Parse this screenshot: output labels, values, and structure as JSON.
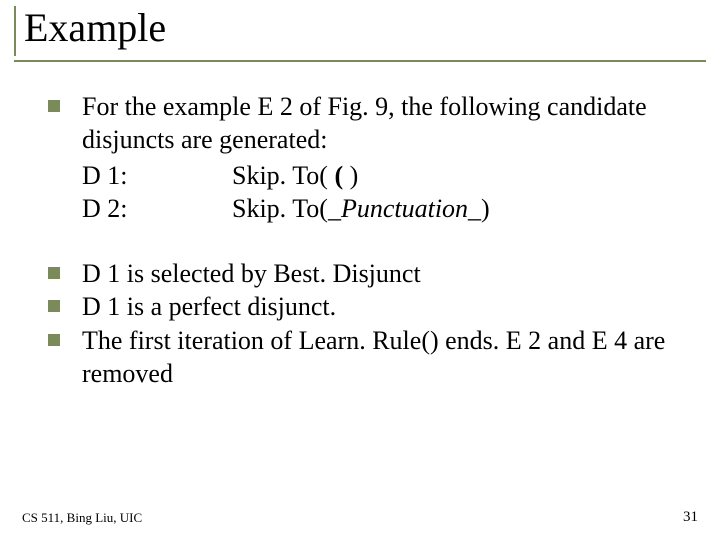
{
  "title": "Example",
  "body": {
    "p1_intro": "For the example E 2 of Fig. 9, the following candidate disjuncts are generated:",
    "rows": [
      {
        "key": "D 1:",
        "val_prefix": "Skip. To( ",
        "val_bold": "(",
        "val_suffix": " )"
      },
      {
        "key": "D 2:",
        "val_prefix": "Skip. To(",
        "val_italic": "_Punctuation_",
        "val_suffix": ")"
      }
    ],
    "p2": "D 1 is selected by Best. Disjunct",
    "p3": "D 1 is a perfect disjunct.",
    "p4": "The first iteration of Learn. Rule() ends. E 2 and E 4 are removed"
  },
  "footer": {
    "left": "CS 511, Bing Liu, UIC",
    "right": "31"
  },
  "colors": {
    "accent": "#7b8a5a"
  }
}
